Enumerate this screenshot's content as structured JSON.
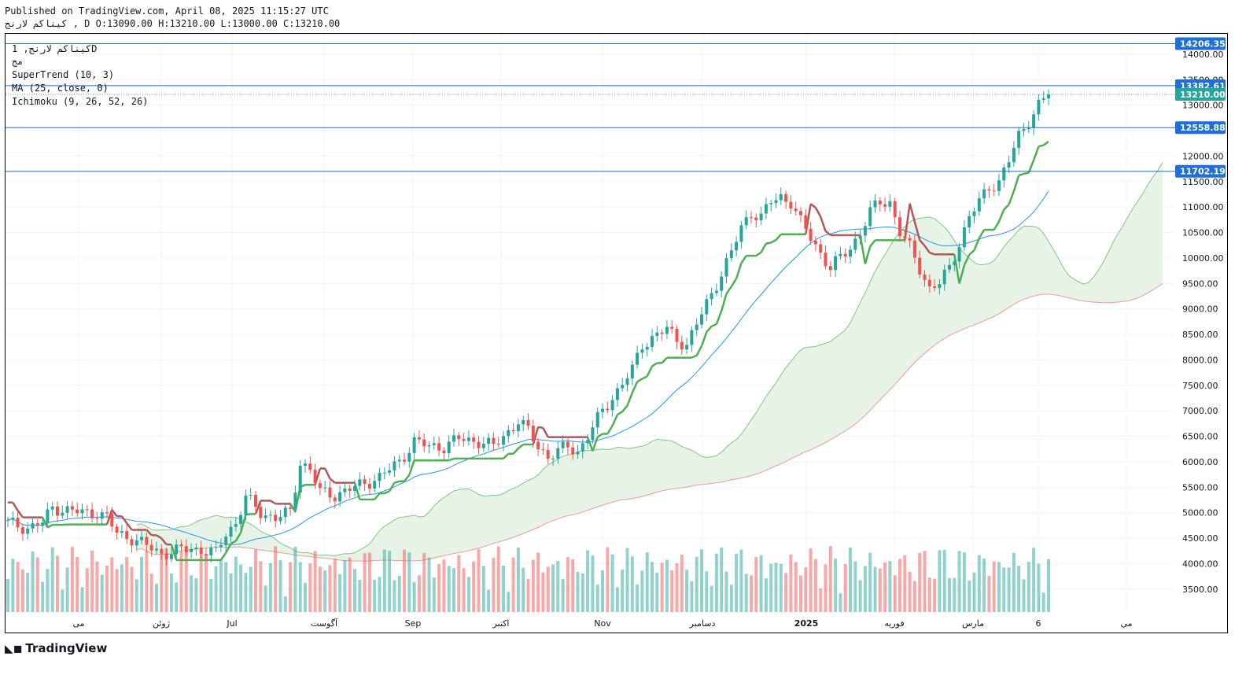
{
  "header": {
    "published": "Published on TradingView.com, April 08, 2025 11:15:27 UTC",
    "ohlc_line": "كيناكم لارنج , D O:13090.00 H:13210.00 L:13000.00 C:13210.00"
  },
  "legend": {
    "symbol": "كيناكم لارنج, 1D",
    "exchange": "مج",
    "supertrend": "SuperTrend (10, 3)",
    "ma": "MA (25, close, 0)",
    "ichimoku": "Ichimoku (9, 26, 52, 26)"
  },
  "logo": {
    "text": "TradingView",
    "icon": "tradingview-logo-icon"
  },
  "colors": {
    "up": "#26a69a",
    "down": "#ef5350",
    "supertrend_up": "#4caf50",
    "supertrend_down": "#b05858",
    "ma": "#2196f3",
    "hline": "#1e6fd9",
    "cloud_up": "#e3f2e3",
    "cloud_down": "#fce4e4"
  },
  "chart_data": {
    "type": "candlestick",
    "ylim": [
      3050,
      14400
    ],
    "y_ticks": [
      "14000.00",
      "13500.00",
      "13000.00",
      "12500.00",
      "12000.00",
      "11500.00",
      "11000.00",
      "10500.00",
      "10000.00",
      "9500.00",
      "9000.00",
      "8500.00",
      "8000.00",
      "7500.00",
      "7000.00",
      "6500.00",
      "6000.00",
      "5500.00",
      "5000.00",
      "4500.00",
      "4000.00",
      "3500.00"
    ],
    "x_labels": [
      "مى",
      "ژوئن",
      "Jul",
      "آگوست",
      "Sep",
      "اکتبر",
      "Nov",
      "دسامبر",
      "2025",
      "فوریه",
      "مارس",
      "6",
      "مى"
    ],
    "x_label_bold": [
      false,
      false,
      false,
      false,
      false,
      false,
      false,
      false,
      true,
      false,
      false,
      false,
      false
    ],
    "price_lines": [
      {
        "label": "14206.35",
        "value": 14206.35
      },
      {
        "label": "13382.61",
        "value": 13382.61
      },
      {
        "label": "12558.88",
        "value": 12558.88
      },
      {
        "label": "11702.19",
        "value": 11702.19
      }
    ],
    "last_price": {
      "label": "13210.00",
      "value": 13210.0
    },
    "close_path": [
      [
        0,
        4800
      ],
      [
        4,
        4700
      ],
      [
        7,
        4800
      ],
      [
        9,
        5100
      ],
      [
        12,
        5050
      ],
      [
        15,
        5000
      ],
      [
        18,
        5000
      ],
      [
        20,
        4900
      ],
      [
        22,
        4600
      ],
      [
        25,
        4500
      ],
      [
        28,
        4350
      ],
      [
        31,
        4200
      ],
      [
        34,
        4250
      ],
      [
        37,
        4300
      ],
      [
        40,
        4250
      ],
      [
        42,
        4200
      ],
      [
        44,
        4600
      ],
      [
        46,
        4800
      ],
      [
        48,
        5300
      ],
      [
        51,
        5000
      ],
      [
        54,
        4900
      ],
      [
        57,
        5000
      ],
      [
        59,
        6000
      ],
      [
        61,
        5850
      ],
      [
        63,
        5400
      ],
      [
        66,
        5350
      ],
      [
        70,
        5500
      ],
      [
        75,
        5700
      ],
      [
        79,
        6000
      ],
      [
        82,
        6400
      ],
      [
        85,
        6300
      ],
      [
        88,
        6300
      ],
      [
        91,
        6450
      ],
      [
        95,
        6400
      ],
      [
        98,
        6300
      ],
      [
        101,
        6600
      ],
      [
        103,
        6800
      ],
      [
        105,
        6600
      ],
      [
        107,
        6300
      ],
      [
        109,
        6100
      ],
      [
        111,
        6200
      ],
      [
        113,
        6300
      ],
      [
        115,
        6200
      ],
      [
        117,
        6500
      ],
      [
        120,
        7000
      ],
      [
        123,
        7400
      ],
      [
        126,
        7800
      ],
      [
        128,
        8300
      ],
      [
        131,
        8500
      ],
      [
        133,
        8600
      ],
      [
        135,
        8400
      ],
      [
        137,
        8300
      ],
      [
        140,
        8900
      ],
      [
        143,
        9500
      ],
      [
        146,
        10100
      ],
      [
        148,
        10600
      ],
      [
        150,
        10900
      ],
      [
        152,
        10800
      ],
      [
        154,
        11100
      ],
      [
        156,
        11200
      ],
      [
        158,
        11100
      ],
      [
        160,
        10700
      ],
      [
        162,
        10400
      ],
      [
        164,
        10100
      ],
      [
        166,
        9800
      ],
      [
        168,
        10000
      ],
      [
        170,
        10200
      ],
      [
        172,
        10500
      ],
      [
        174,
        10900
      ],
      [
        176,
        11100
      ],
      [
        178,
        11100
      ],
      [
        180,
        10500
      ],
      [
        182,
        10200
      ],
      [
        184,
        9800
      ],
      [
        186,
        9400
      ],
      [
        188,
        9500
      ],
      [
        190,
        9800
      ],
      [
        192,
        10300
      ],
      [
        194,
        10800
      ],
      [
        196,
        11100
      ],
      [
        198,
        11400
      ],
      [
        200,
        11500
      ],
      [
        202,
        11900
      ],
      [
        204,
        12400
      ],
      [
        206,
        12700
      ],
      [
        208,
        13000
      ],
      [
        210,
        13210
      ]
    ],
    "volume_ylim": [
      0,
      1
    ],
    "n_bars": 211
  }
}
